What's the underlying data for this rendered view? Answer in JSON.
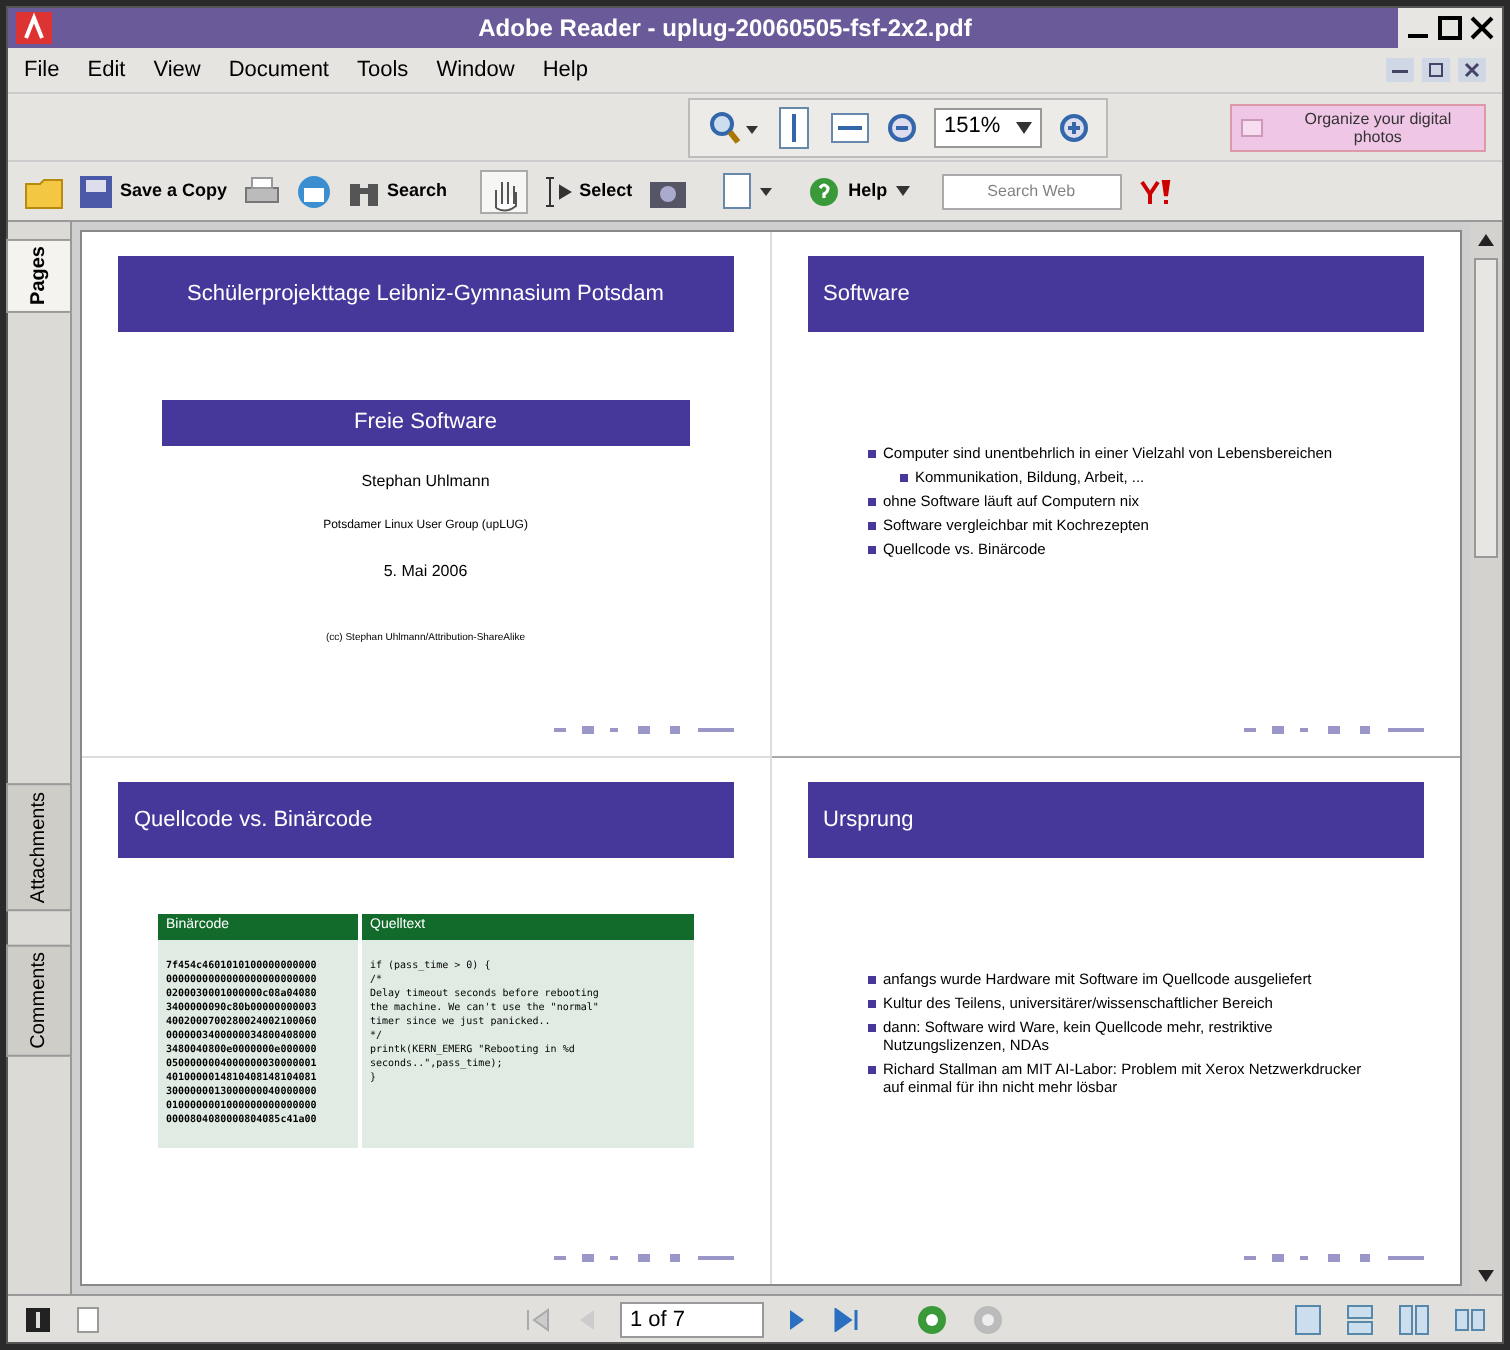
{
  "window": {
    "title": "Adobe Reader - uplug-20060505-fsf-2x2.pdf"
  },
  "menu": [
    "File",
    "Edit",
    "View",
    "Document",
    "Tools",
    "Window",
    "Help"
  ],
  "zoom": {
    "value": "151%"
  },
  "promo": {
    "text": "Organize your digital photos"
  },
  "toolbar": {
    "save": "Save a Copy",
    "search": "Search",
    "select": "Select",
    "help": "Help",
    "search_web": {
      "placeholder": "Search Web"
    }
  },
  "side_tabs": [
    {
      "label": "Pages",
      "selected": true
    },
    {
      "label": "Attachments",
      "selected": false
    },
    {
      "label": "Comments",
      "selected": false
    }
  ],
  "slides": [
    {
      "kind": "title",
      "header": "Schülerprojekttage Leibniz-Gymnasium Potsdam",
      "title": "Freie Software",
      "author": "Stephan Uhlmann",
      "group": "Potsdamer Linux User Group (upLUG)",
      "date": "5. Mai 2006",
      "license": "(cc) Stephan Uhlmann/Attribution-ShareAlike"
    },
    {
      "kind": "bullets",
      "header": "Software",
      "items": [
        {
          "text": "Computer sind unentbehrlich in einer Vielzahl von Lebensbereichen",
          "children": [
            {
              "text": "Kommunikation, Bildung, Arbeit, ..."
            }
          ]
        },
        {
          "text": "ohne Software läuft auf Computern nix"
        },
        {
          "text": "Software vergleichbar mit Kochrezepten"
        },
        {
          "text": "Quellcode vs. Binärcode"
        }
      ]
    },
    {
      "kind": "table",
      "header": "Quellcode vs. Binärcode",
      "columns": [
        "Binärcode",
        "Quelltext"
      ],
      "binary": [
        "7f454c4601010100000000000",
        "0000000000000000000000000",
        "0200030001000000c08a04080",
        "3400000090c80b00000000003",
        "4002000700280024002100060",
        "0000003400000034800408000",
        "3480040800e0000000e000000",
        "0500000004000000030000001",
        "4010000014810408148104081",
        "3000000013000000040000000",
        "0100000001000000000000000",
        "0000804080000804085c41a00"
      ],
      "code": [
        "if (pass_time > 0) {",
        "/*",
        "Delay timeout seconds before rebooting",
        "the machine. We can't use the \"normal\"",
        "timer since we just panicked..",
        "*/",
        "printk(KERN_EMERG \"Rebooting in %d",
        "seconds..\",pass_time);",
        "}"
      ]
    },
    {
      "kind": "bullets",
      "header": "Ursprung",
      "items": [
        {
          "text": "anfangs wurde Hardware mit Software im Quellcode ausgeliefert"
        },
        {
          "text": "Kultur des Teilens, universitärer/wissenschaftlicher Bereich"
        },
        {
          "text": "dann: Software wird Ware, kein Quellcode mehr, restriktive Nutzungslizenzen, NDAs"
        },
        {
          "text": "Richard Stallman am MIT AI-Labor: Problem mit Xerox Netzwerkdrucker auf einmal für ihn nicht mehr lösbar"
        }
      ]
    }
  ],
  "status": {
    "page": "1 of 7"
  }
}
